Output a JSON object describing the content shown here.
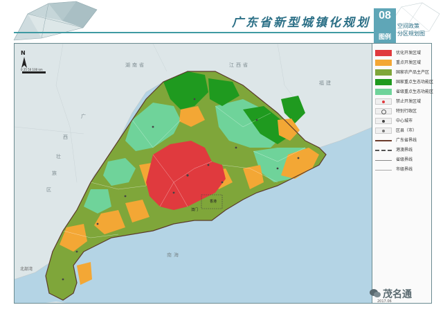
{
  "header": {
    "title": "广东省新型城镇化规划",
    "badge_number": "08",
    "badge_sub": "图例",
    "policy_line1": "空间政策",
    "policy_line2": "分区规划图"
  },
  "map": {
    "north_label": "N",
    "scale_label": "0  25 50  100  km",
    "neighbor_labels": {
      "hunan": "湖南省",
      "jiangxi": "江西省",
      "fujian": "福建",
      "guangxi_a": "广",
      "guangxi_b": "西",
      "guangxi_c": "壮",
      "guangxi_d": "族",
      "guangxi_e": "区",
      "beibu": "北部湾",
      "sea": "南海"
    },
    "city_labels": {
      "macau": "澳门",
      "hk": "香港"
    },
    "colors": {
      "sea": "#b4d4e5",
      "land_outside": "#dde6e8",
      "red": "#e03a3e",
      "orange": "#f3a735",
      "olive": "#7fa63a",
      "darkgreen": "#1f9a1f",
      "lightgreen": "#6fd39a"
    }
  },
  "legend": {
    "items": [
      {
        "label": "优化开发区域",
        "color": "#e03a3e",
        "kind": "fill"
      },
      {
        "label": "重点开发区域",
        "color": "#f3a735",
        "kind": "fill"
      },
      {
        "label": "国家农产品主产区",
        "color": "#7fa63a",
        "kind": "fill"
      },
      {
        "label": "国家重点生态功能区",
        "color": "#1f9a1f",
        "kind": "fill"
      },
      {
        "label": "省级重点生态功能区",
        "color": "#6fd39a",
        "kind": "fill"
      },
      {
        "label": "禁止开发区域",
        "color": "#e03a3e",
        "kind": "dot"
      },
      {
        "label": "特别行政区",
        "color": "#555555",
        "kind": "ring"
      },
      {
        "label": "中心城市",
        "color": "#444444",
        "kind": "dot"
      },
      {
        "label": "区县（市）",
        "color": "#777777",
        "kind": "dot"
      },
      {
        "label": "广东省界线",
        "color": "#6a3a2a",
        "kind": "line"
      },
      {
        "label": "港澳界线",
        "color": "#555555",
        "kind": "dashline"
      },
      {
        "label": "省级界线",
        "color": "#888888",
        "kind": "thinline"
      },
      {
        "label": "市级界线",
        "color": "#aaaaaa",
        "kind": "thinline"
      }
    ]
  },
  "footer": {
    "date": "2017.06",
    "watermark": "茂名通"
  }
}
